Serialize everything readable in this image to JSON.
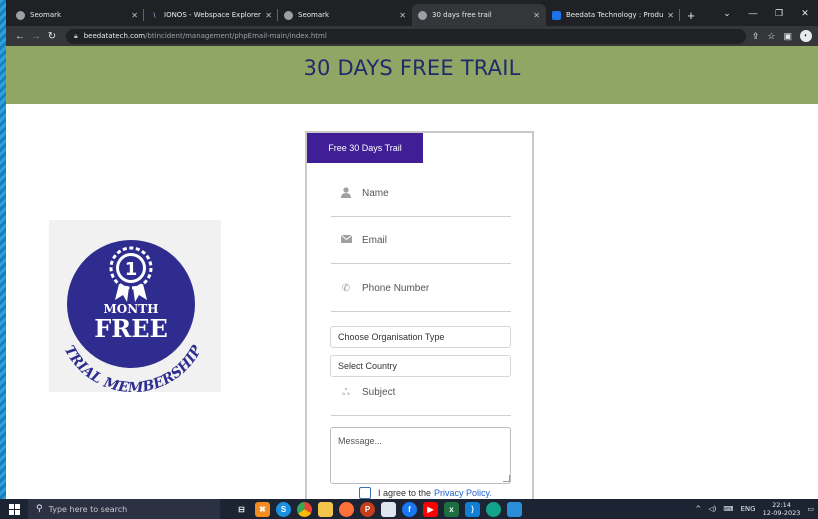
{
  "browser": {
    "tabs": [
      {
        "title": "Seomark",
        "fav_color": "#9aa0a6"
      },
      {
        "title": "IONOS - Webspace Explorer",
        "fav_color": "#ffffff"
      },
      {
        "title": "Seomark",
        "fav_color": "#9aa0a6"
      },
      {
        "title": "30 days free trail",
        "fav_color": "#9aa0a6",
        "active": true
      },
      {
        "title": "Beedata Technology : Products",
        "fav_color": "#1a73e8"
      }
    ],
    "url_host": "beedatatech.com",
    "url_path": "/btincident/management/phpEmail-main/index.html"
  },
  "page": {
    "heading": "30 DAYS FREE TRAIL",
    "badge": {
      "number": "1",
      "line1": "MONTH",
      "line2": "FREE",
      "arc_text": "TRIAL MEMBERSHIP"
    },
    "form": {
      "tab_label": "Free 30 Days Trail",
      "name_placeholder": "Name",
      "email_placeholder": "Email",
      "phone_placeholder": "Phone Number",
      "org_type": "Choose Organisation Type",
      "country": "Select Country",
      "subject_placeholder": "Subject",
      "message_placeholder": "Message...",
      "agree_text": "I agree to the",
      "privacy_link": "Privacy Policy."
    }
  },
  "taskbar": {
    "search_placeholder": "Type here to search",
    "language": "ENG",
    "time": "22:14",
    "date": "12-09-2023"
  },
  "colors": {
    "hero_bg": "#8fa665",
    "heading": "#1f2a6b",
    "form_tab": "#3f1e96",
    "badge_blue": "#2e2d8f"
  }
}
